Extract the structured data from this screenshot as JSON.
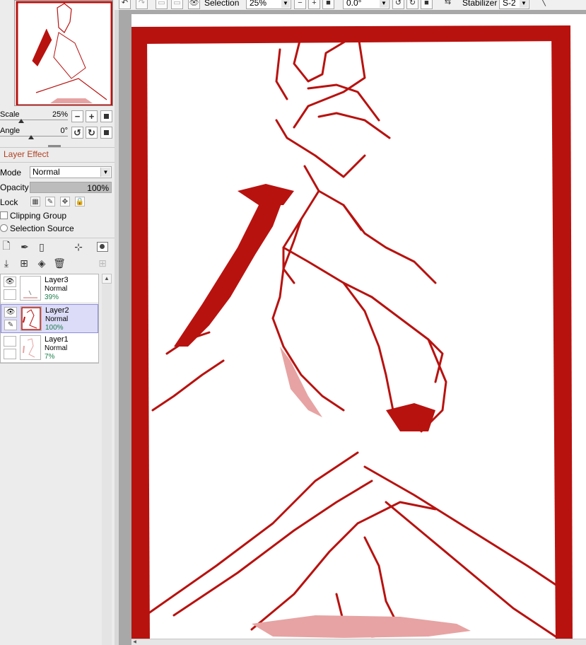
{
  "toolbar": {
    "view_label": "Selection",
    "zoom_value": "25%",
    "angle_value": "0.0°",
    "stabilizer_label": "Stabilizer",
    "stabilizer_value": "S-2"
  },
  "navigator": {
    "scale_label": "Scale",
    "scale_value": "25%",
    "angle_label": "Angle",
    "angle_value": "0°"
  },
  "layer_effect": {
    "title": "Layer Effect",
    "mode_label": "Mode",
    "mode_value": "Normal",
    "opacity_label": "Opacity",
    "opacity_value": "100%",
    "opacity_level": 1.0,
    "lock_label": "Lock",
    "clipping_label": "Clipping Group",
    "selection_source_label": "Selection Source"
  },
  "layers": [
    {
      "name": "Layer3",
      "mode": "Normal",
      "opacity": "39%",
      "visible": true,
      "selected": false
    },
    {
      "name": "Layer2",
      "mode": "Normal",
      "opacity": "100%",
      "visible": true,
      "selected": true
    },
    {
      "name": "Layer1",
      "mode": "Normal",
      "opacity": "7%",
      "visible": false,
      "selected": false
    }
  ],
  "colors": {
    "ink": "#b8120f",
    "accent_label": "#b04020",
    "layer_selected_bg": "#dcdcf8",
    "opacity_text": "#1d7f4e"
  },
  "icons": {
    "view": "eye-icon",
    "zoom_out": "minus-icon",
    "zoom_in": "plus-icon",
    "reset": "reset-icon",
    "rotate_left": "rotate-ccw-icon",
    "rotate_right": "rotate-cw-icon",
    "flip": "flip-horizontal-icon",
    "new_layer": "new-layer-icon",
    "delete_layer": "trash-icon"
  }
}
